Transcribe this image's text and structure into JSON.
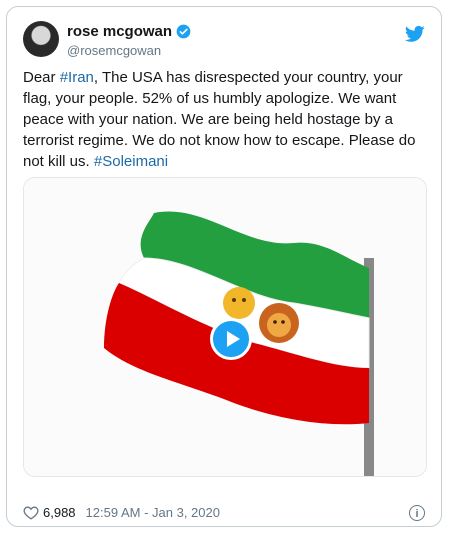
{
  "author": {
    "name": "rose mcgowan",
    "handle": "@rosemcgowan",
    "verified": true
  },
  "tweet": {
    "parts": [
      {
        "text": "Dear ",
        "link": false
      },
      {
        "text": "#Iran",
        "link": true
      },
      {
        "text": ", The USA has disrespected your country, your flag, your people. 52% of us humbly apologize. We want peace with your nation. We are being held hostage by a terrorist regime. We do not know how to escape. Please do not kill us. ",
        "link": false
      },
      {
        "text": "#Soleimani",
        "link": true
      }
    ]
  },
  "media": {
    "type": "gif-video",
    "description_icon": "play-icon"
  },
  "footer": {
    "likes": "6,988",
    "timestamp": "12:59 AM - Jan 3, 2020"
  },
  "colors": {
    "link": "#1b6aa7",
    "twitter_blue": "#1da1f2",
    "flag_green": "#239f40",
    "flag_red": "#da0000"
  }
}
